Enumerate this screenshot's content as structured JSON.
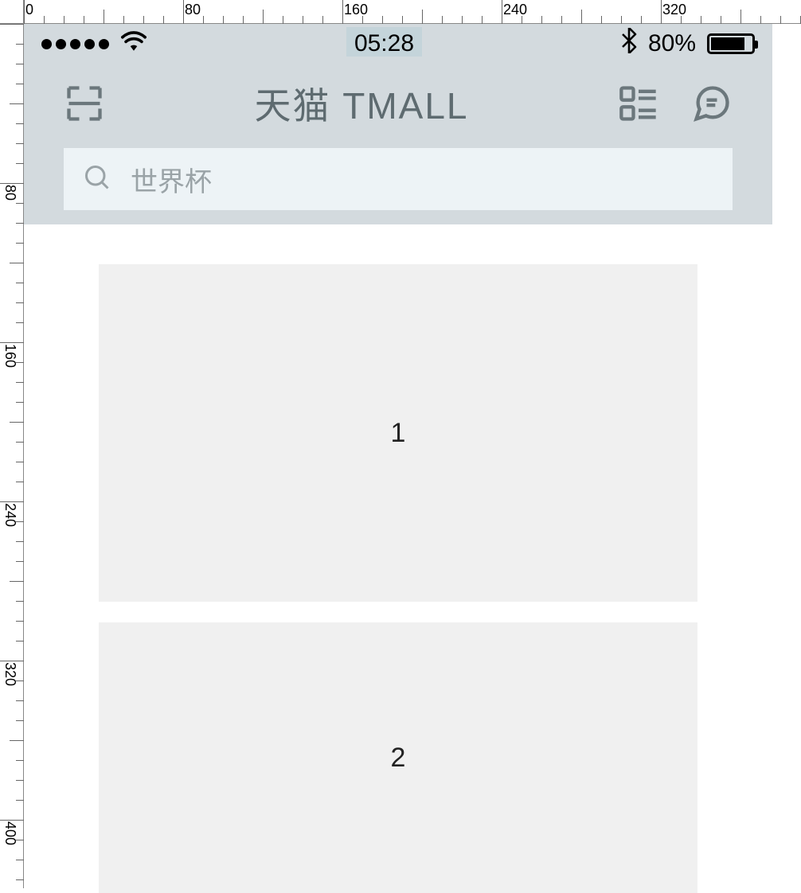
{
  "ruler": {
    "h_labels": [
      "0",
      "80",
      "160",
      "240",
      "320"
    ],
    "v_labels": [
      "80",
      "160",
      "240",
      "320",
      "400"
    ]
  },
  "status": {
    "time": "05:28",
    "battery_pct": "80%"
  },
  "header": {
    "title": "天猫 TMALL"
  },
  "search": {
    "placeholder": "世界杯"
  },
  "cards": [
    {
      "label": "1"
    },
    {
      "label": "2"
    }
  ]
}
